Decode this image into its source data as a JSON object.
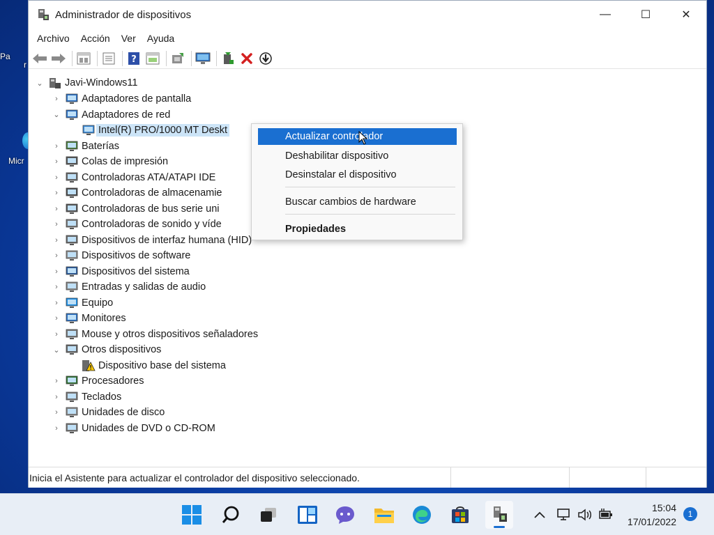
{
  "window": {
    "title": "Administrador de dispositivos",
    "controls": {
      "minimize": "—",
      "maximize": "☐",
      "close": "✕"
    }
  },
  "menu": [
    "Archivo",
    "Acción",
    "Ver",
    "Ayuda"
  ],
  "toolbar": {
    "icons": [
      "back-arrow-icon",
      "forward-arrow-icon",
      "properties-icon",
      "devices-view-icon",
      "help-icon",
      "show-hidden-icon",
      "update-driver-icon",
      "scan-hardware-icon",
      "enable-device-icon",
      "uninstall-device-icon",
      "disable-device-icon"
    ]
  },
  "tree": {
    "root": "Javi-Windows11",
    "items": [
      {
        "label": "Adaptadores de pantalla",
        "expanded": false
      },
      {
        "label": "Adaptadores de red",
        "expanded": true
      },
      {
        "label": "Intel(R) PRO/1000 MT Deskt",
        "child": true,
        "selected": true
      },
      {
        "label": "Baterías",
        "expanded": false
      },
      {
        "label": "Colas de impresión",
        "expanded": false
      },
      {
        "label": "Controladoras ATA/ATAPI IDE",
        "expanded": false
      },
      {
        "label": "Controladoras de almacenamie",
        "expanded": false
      },
      {
        "label": "Controladoras de bus serie uni",
        "expanded": false
      },
      {
        "label": "Controladoras de sonido y víde",
        "expanded": false
      },
      {
        "label": "Dispositivos de interfaz humana (HID)",
        "expanded": false
      },
      {
        "label": "Dispositivos de software",
        "expanded": false
      },
      {
        "label": "Dispositivos del sistema",
        "expanded": false
      },
      {
        "label": "Entradas y salidas de audio",
        "expanded": false
      },
      {
        "label": "Equipo",
        "expanded": false
      },
      {
        "label": "Monitores",
        "expanded": false
      },
      {
        "label": "Mouse y otros dispositivos señaladores",
        "expanded": false
      },
      {
        "label": "Otros dispositivos",
        "expanded": true
      },
      {
        "label": "Dispositivo base del sistema",
        "child": true,
        "warning": true
      },
      {
        "label": "Procesadores",
        "expanded": false
      },
      {
        "label": "Teclados",
        "expanded": false
      },
      {
        "label": "Unidades de disco",
        "expanded": false
      },
      {
        "label": "Unidades de DVD o CD-ROM",
        "expanded": false
      }
    ]
  },
  "context_menu": {
    "items": [
      {
        "label": "Actualizar controlador",
        "highlighted": true
      },
      {
        "label": "Deshabilitar dispositivo"
      },
      {
        "label": "Desinstalar el dispositivo"
      },
      {
        "label": "Buscar cambios de hardware"
      },
      {
        "label": "Propiedades",
        "bold": true
      }
    ]
  },
  "statusbar": {
    "text": "Inicia el Asistente para actualizar el controlador del dispositivo seleccionado."
  },
  "desktop": {
    "icon1_label": "Pa",
    "icon1_label2": "r",
    "icon2_label": "Micr"
  },
  "taskbar": {
    "apps": [
      "windows-start-icon",
      "search-icon",
      "task-view-icon",
      "widgets-icon",
      "chat-icon",
      "file-explorer-icon",
      "edge-browser-icon",
      "store-icon",
      "device-manager-icon"
    ],
    "time": "15:04",
    "date": "17/01/2022",
    "notifications": "1"
  },
  "colors": {
    "accent": "#1a6fd1",
    "selection": "#cce4f7",
    "error_red": "#d42020"
  }
}
